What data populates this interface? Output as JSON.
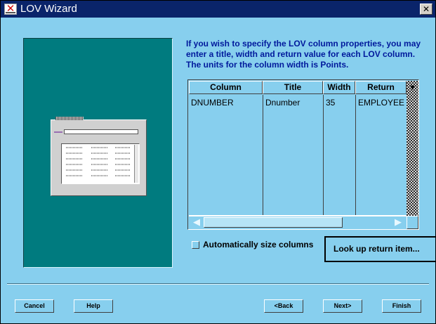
{
  "window": {
    "title": "LOV Wizard",
    "close_glyph": "✕"
  },
  "description": "If you wish to specify the LOV column properties, you may enter a title, width and return value for each LOV column. The units for the column width is Points.",
  "table": {
    "columns": [
      "Column",
      "Title",
      "Width",
      "Return"
    ],
    "rows": [
      [
        "DNUMBER",
        "Dnumber",
        "35",
        "EMPLOYEE"
      ]
    ]
  },
  "auto_size_label": "Automatically size columns",
  "auto_size_checked": false,
  "lookup_button": "Look up return item...",
  "buttons": {
    "cancel": "Cancel",
    "help": "Help",
    "back": "<Back",
    "next": "Next>",
    "finish": "Finish"
  },
  "icons": {
    "app": "oracle-forms-x-icon",
    "close": "close-icon"
  },
  "colors": {
    "background": "#87cfee",
    "title_bar": "#0a246a",
    "illustration": "#007b7f",
    "description_text": "#00199c"
  }
}
